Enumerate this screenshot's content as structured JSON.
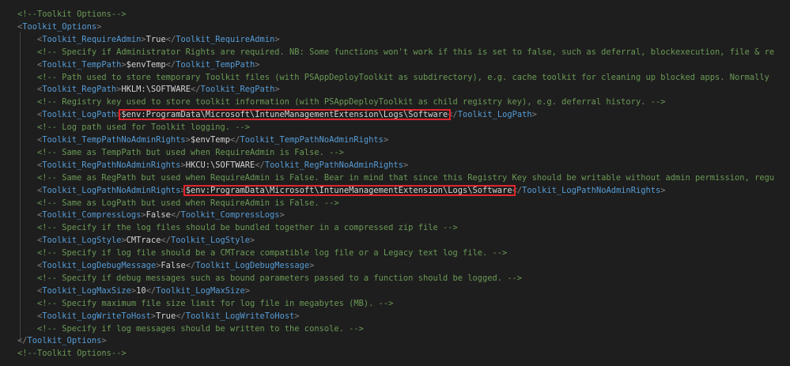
{
  "outer_comment": "<!--Toolkit Options-->",
  "root_open": "Toolkit_Options",
  "root_close": "Toolkit_Options",
  "entries": [
    {
      "tag": "Toolkit_RequireAdmin",
      "value": "True",
      "comment": "<!-- Specify if Administrator Rights are required. NB: Some functions won't work if this is set to false, such as deferral, blockexecution, file & re"
    },
    {
      "tag": "Toolkit_TempPath",
      "value": "$envTemp",
      "comment": "<!-- Path used to store temporary Toolkit files (with PSAppDeployToolkit as subdirectory), e.g. cache toolkit for cleaning up blocked apps. Normally"
    },
    {
      "tag": "Toolkit_RegPath",
      "value": "HKLM:\\SOFTWARE",
      "comment": "<!-- Registry key used to store toolkit information (with PSAppDeployToolkit as child registry key), e.g. deferral history. -->"
    },
    {
      "tag": "Toolkit_LogPath",
      "value": "$env:ProgramData\\Microsoft\\IntuneManagementExtension\\Logs\\Software",
      "comment": "<!-- Log path used for Toolkit logging. -->"
    },
    {
      "tag": "Toolkit_TempPathNoAdminRights",
      "value": "$envTemp",
      "comment": "<!-- Same as TempPath but used when RequireAdmin is False. -->"
    },
    {
      "tag": "Toolkit_RegPathNoAdminRights",
      "value": "HKCU:\\SOFTWARE",
      "comment": "<!-- Same as RegPath but used when RequireAdmin is False. Bear in mind that since this Registry Key should be writable without admin permission, regu"
    },
    {
      "tag": "Toolkit_LogPathNoAdminRights",
      "value": "$env:ProgramData\\Microsoft\\IntuneManagementExtension\\Logs\\Software",
      "comment": "<!-- Same as LogPath but used when RequireAdmin is False. -->"
    },
    {
      "tag": "Toolkit_CompressLogs",
      "value": "False",
      "comment": "<!-- Specify if the log files should be bundled together in a compressed zip file -->"
    },
    {
      "tag": "Toolkit_LogStyle",
      "value": "CMTrace",
      "comment": "<!-- Specify if log file should be a CMTrace compatible log file or a Legacy text log file. -->"
    },
    {
      "tag": "Toolkit_LogDebugMessage",
      "value": "False",
      "comment": "<!-- Specify if debug messages such as bound parameters passed to a function should be logged. -->"
    },
    {
      "tag": "Toolkit_LogMaxSize",
      "value": "10",
      "comment": "<!-- Specify maximum file size limit for log file in megabytes (MB). -->"
    },
    {
      "tag": "Toolkit_LogWriteToHost",
      "value": "True",
      "comment": "<!-- Specify if log messages should be written to the console. -->"
    }
  ],
  "colors": {
    "background": "#1e1e1e",
    "comment": "#6a9955",
    "tag": "#569cd6",
    "punctuation": "#808080",
    "text": "#d4d4d4",
    "highlight_box": "#e0252c"
  }
}
